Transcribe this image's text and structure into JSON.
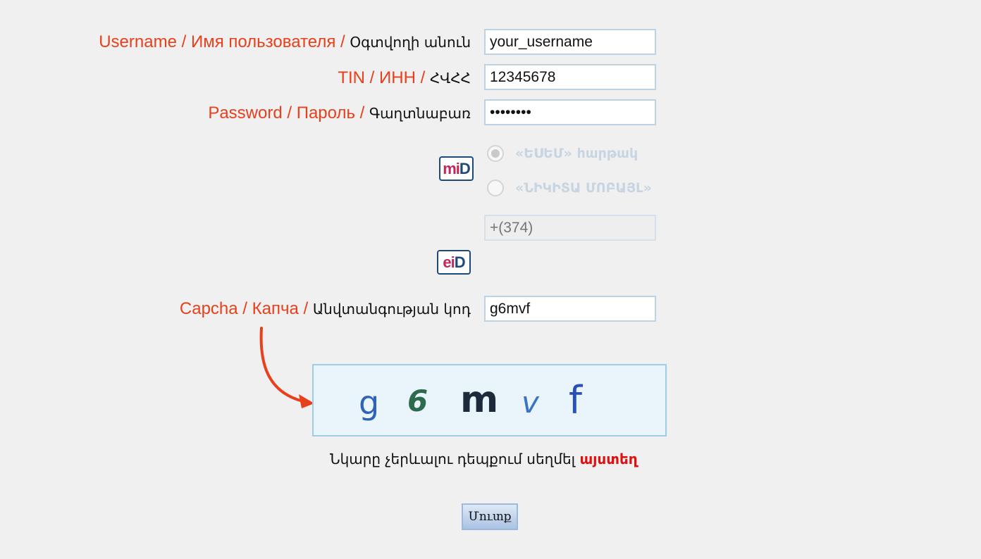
{
  "form": {
    "username": {
      "label_en": "Username",
      "label_ru": "Имя пользователя",
      "label_hy": "Օգտվողի անուն",
      "value": "your_username"
    },
    "tin": {
      "label_en": "TIN",
      "label_ru": "ИНН",
      "label_hy": "ՀՎՀՀ",
      "value": "12345678"
    },
    "password": {
      "label_en": "Password",
      "label_ru": "Пароль",
      "label_hy": "Գաղտնաբառ",
      "value": "••••••••"
    },
    "mid": {
      "logo_a": "mi",
      "logo_b": "D",
      "options": [
        {
          "label": "«ԵՍԵՄ» հարթակ",
          "selected": true
        },
        {
          "label": "«ՆԻԿԻՏԱ ՄՈԲԱՅԼ»",
          "selected": false
        }
      ],
      "phone_placeholder": "+(374)"
    },
    "eid": {
      "logo_a": "ei",
      "logo_b": "D"
    },
    "captcha": {
      "label_en": "Capcha",
      "label_ru": "Капча",
      "label_hy": "Անվտանգության կոդ",
      "value": "g6mvf",
      "chars": [
        {
          "char": "g",
          "color": "#2f63b5"
        },
        {
          "char": "6",
          "color": "#2e6b4e"
        },
        {
          "char": "m",
          "color": "#1c2a3a"
        },
        {
          "char": "v",
          "color": "#3b73c4"
        },
        {
          "char": "f",
          "color": "#2750b8"
        }
      ]
    },
    "refresh_text": "Նկարը չերևալու դեպքում սեղմել",
    "refresh_link": "այստեղ",
    "submit_label": "Մուտք"
  },
  "colors": {
    "label_accent": "#e8401c",
    "arrow": "#e8401c",
    "link": "#e01010"
  }
}
